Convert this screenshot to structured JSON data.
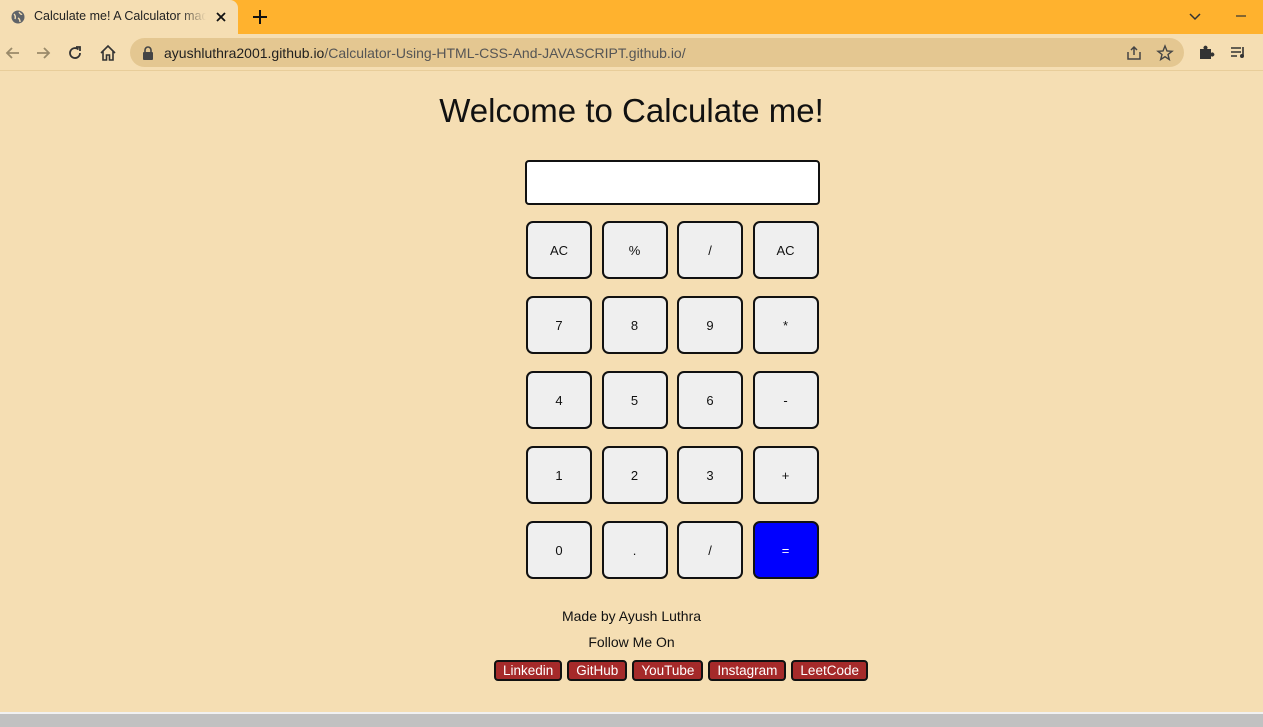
{
  "browser": {
    "tab_title": "Calculate me! A Calculator made using HTML, CSS and JavaScript",
    "url_domain": "ayushluthra2001.github.io",
    "url_path": "/Calculator-Using-HTML-CSS-And-JAVASCRIPT.github.io/",
    "colors": {
      "tabbar": "#ffb22e",
      "page_bg": "#f5deb3"
    }
  },
  "page": {
    "title": "Welcome to Calculate me!",
    "display_value": "",
    "keys": [
      {
        "label": "AC"
      },
      {
        "label": "%"
      },
      {
        "label": "/"
      },
      {
        "label": "AC"
      },
      {
        "label": "7"
      },
      {
        "label": "8"
      },
      {
        "label": "9"
      },
      {
        "label": "*"
      },
      {
        "label": "4"
      },
      {
        "label": "5"
      },
      {
        "label": "6"
      },
      {
        "label": "-"
      },
      {
        "label": "1"
      },
      {
        "label": "2"
      },
      {
        "label": "3"
      },
      {
        "label": "+"
      },
      {
        "label": "0"
      },
      {
        "label": "."
      },
      {
        "label": "/"
      },
      {
        "label": "="
      }
    ],
    "equals_color": "#0000ff",
    "made_by": "Made by Ayush Luthra",
    "follow": "Follow Me On",
    "socials": [
      {
        "label": "Linkedin"
      },
      {
        "label": "GitHub"
      },
      {
        "label": "YouTube"
      },
      {
        "label": "Instagram"
      },
      {
        "label": "LeetCode"
      }
    ],
    "social_color": "#a52a2a"
  }
}
